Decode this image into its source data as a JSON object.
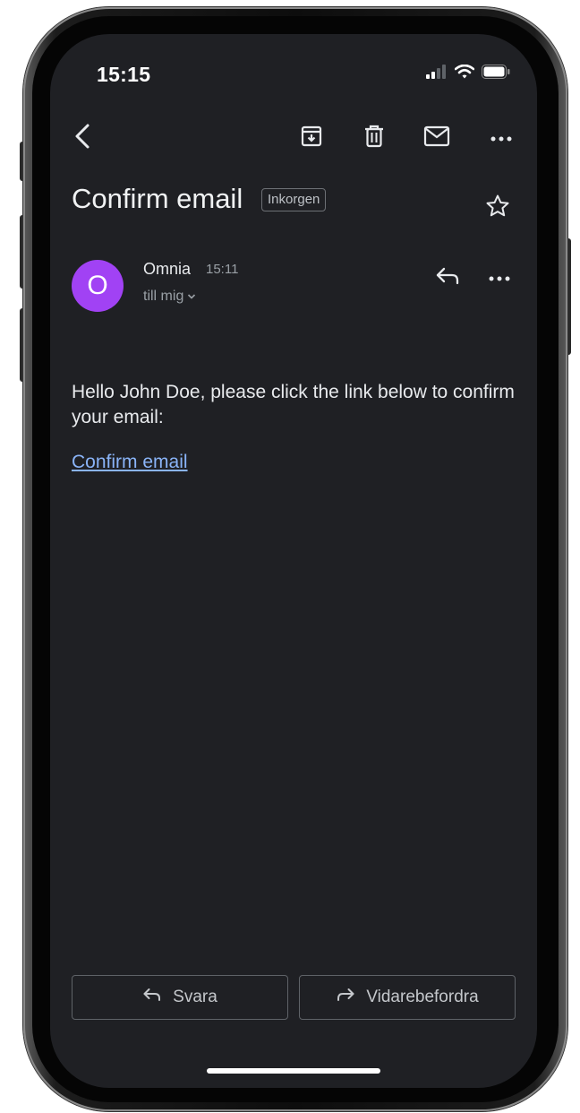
{
  "status_bar": {
    "time": "15:15",
    "icons": [
      "cellular-signal-icon",
      "wifi-icon",
      "battery-icon"
    ]
  },
  "toolbar": {
    "icons": [
      "back-arrow-icon",
      "archive-icon",
      "trash-icon",
      "mark-unread-icon",
      "more-horizontal-icon"
    ]
  },
  "email": {
    "subject": "Confirm email",
    "label": "Inkorgen",
    "sender": {
      "initial": "O",
      "name": "Omnia",
      "time": "15:11",
      "recipient": "till mig",
      "avatar_color": "#a142f4"
    },
    "body": "Hello John Doe, please click the link below to confirm your email:",
    "link_text": "Confirm email"
  },
  "actions": {
    "reply_label": "Svara",
    "forward_label": "Vidarebefordra"
  },
  "colors": {
    "background": "#1f2024",
    "text": "#e8eaed",
    "secondary_text": "#9aa0a6",
    "link": "#8ab4f8"
  }
}
